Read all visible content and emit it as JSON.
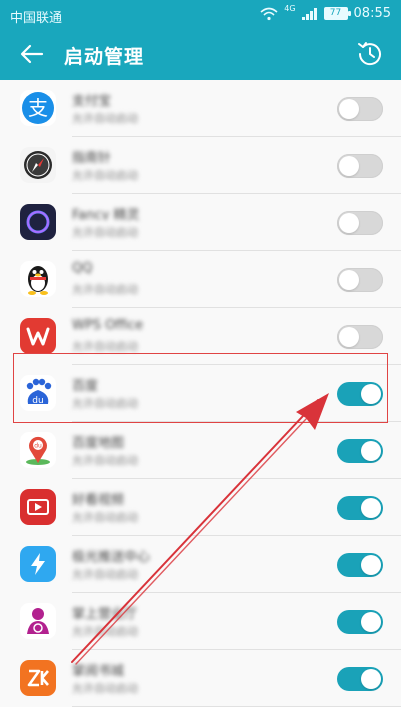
{
  "status": {
    "carrier": "中国联通",
    "network": "4G",
    "battery": "77",
    "time": "08:55"
  },
  "appbar": {
    "title": "启动管理"
  },
  "apps": [
    {
      "name": "支付宝",
      "desc": "允许自动启动",
      "icon": "alipay-icon",
      "enabled": false
    },
    {
      "name": "指南针",
      "desc": "允许自动启动",
      "icon": "compass-icon",
      "enabled": false
    },
    {
      "name": "Fancy 精灵",
      "desc": "允许自动启动",
      "icon": "ring-icon",
      "enabled": false
    },
    {
      "name": "QQ",
      "desc": "允许自动启动",
      "icon": "qq-icon",
      "enabled": false
    },
    {
      "name": "WPS Office",
      "desc": "允许自动启动",
      "icon": "wps-icon",
      "enabled": false
    },
    {
      "name": "百度",
      "desc": "允许自动启动",
      "icon": "baidu-icon",
      "enabled": true
    },
    {
      "name": "百度地图",
      "desc": "允许自动启动",
      "icon": "map-pin-icon",
      "enabled": true
    },
    {
      "name": "好看视频",
      "desc": "允许自动启动",
      "icon": "video-icon",
      "enabled": true
    },
    {
      "name": "极光推送中心",
      "desc": "允许自动启动",
      "icon": "bolt-icon",
      "enabled": true
    },
    {
      "name": "掌上营业厅",
      "desc": "允许自动启动",
      "icon": "unicom-icon",
      "enabled": true
    },
    {
      "name": "掌阅书城",
      "desc": "允许自动启动",
      "icon": "zk-icon",
      "enabled": true
    }
  ],
  "colors": {
    "accent": "#19a7bd",
    "toggle_on": "#1aa2b8",
    "annotation": "#e04444"
  }
}
